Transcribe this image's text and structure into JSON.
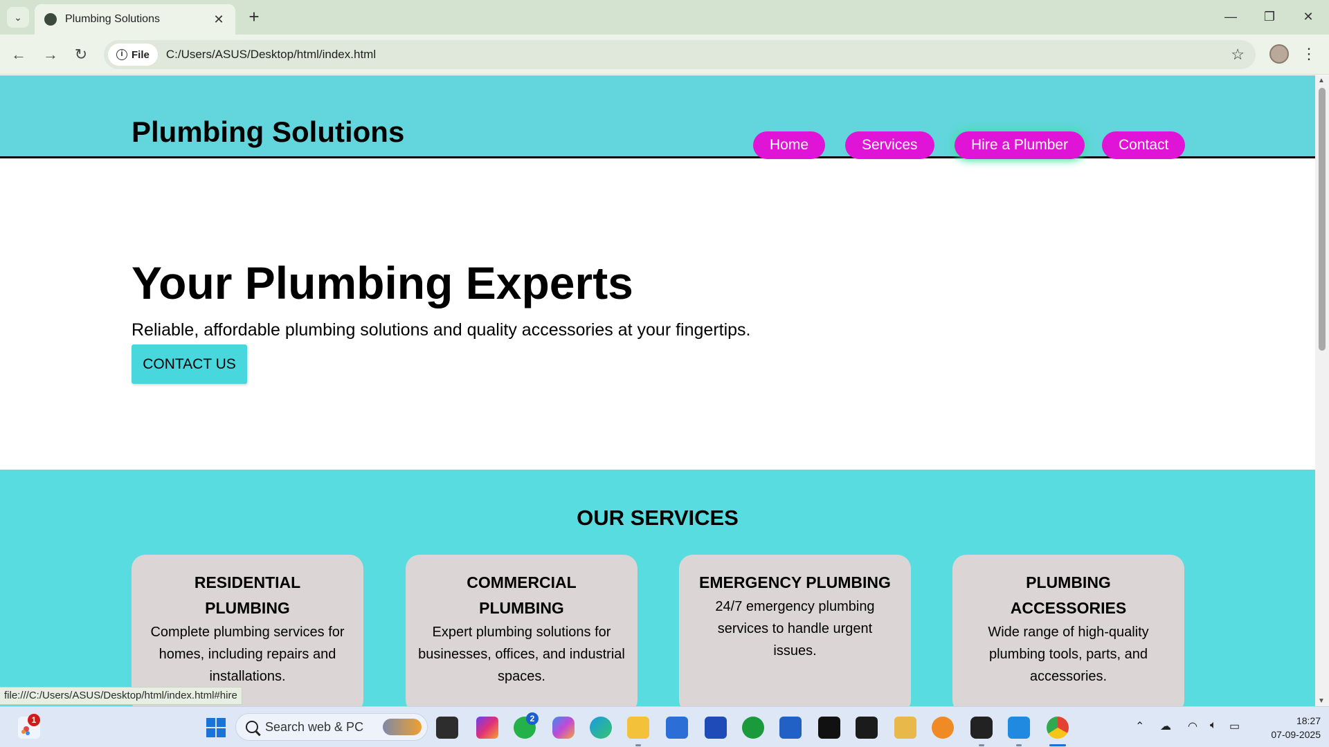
{
  "browser": {
    "tab_title": "Plumbing Solutions",
    "tab_close": "✕",
    "new_tab": "+",
    "site_chip": "File",
    "url": "C:/Users/ASUS/Desktop/html/index.html",
    "status_url": "file:///C:/Users/ASUS/Desktop/html/index.html#hire"
  },
  "header": {
    "logo": "Plumbing Solutions",
    "nav": [
      "Home",
      "Services",
      "Hire a Plumber",
      "Contact"
    ]
  },
  "hero": {
    "title": "Your Plumbing Experts",
    "subtitle": "Reliable, affordable plumbing solutions and quality accessories at your fingertips.",
    "cta": "CONTACT US"
  },
  "services": {
    "title": "OUR SERVICES",
    "cards": [
      {
        "title": "RESIDENTIAL PLUMBING",
        "text": "Complete plumbing services for homes, including repairs and installations."
      },
      {
        "title": "COMMERCIAL PLUMBING",
        "text": "Expert plumbing solutions for businesses, offices, and industrial spaces."
      },
      {
        "title": "EMERGENCY PLUMBING",
        "text": "24/7 emergency plumbing services to handle urgent issues."
      },
      {
        "title": "PLUMBING ACCESSORIES",
        "text": "Wide range of high-quality plumbing tools, parts, and accessories."
      }
    ]
  },
  "taskbar": {
    "search_placeholder": "Search web & PC",
    "notif_badge": "1",
    "whatsapp_badge": "2",
    "time": "18:27",
    "date": "07-09-2025"
  },
  "colors": {
    "header_bg": "#62d6dc",
    "nav_pill": "#e014d6",
    "cta_bg": "#47d7dd",
    "services_bg": "#58dcdf",
    "card_bg": "#dcd5d6"
  }
}
